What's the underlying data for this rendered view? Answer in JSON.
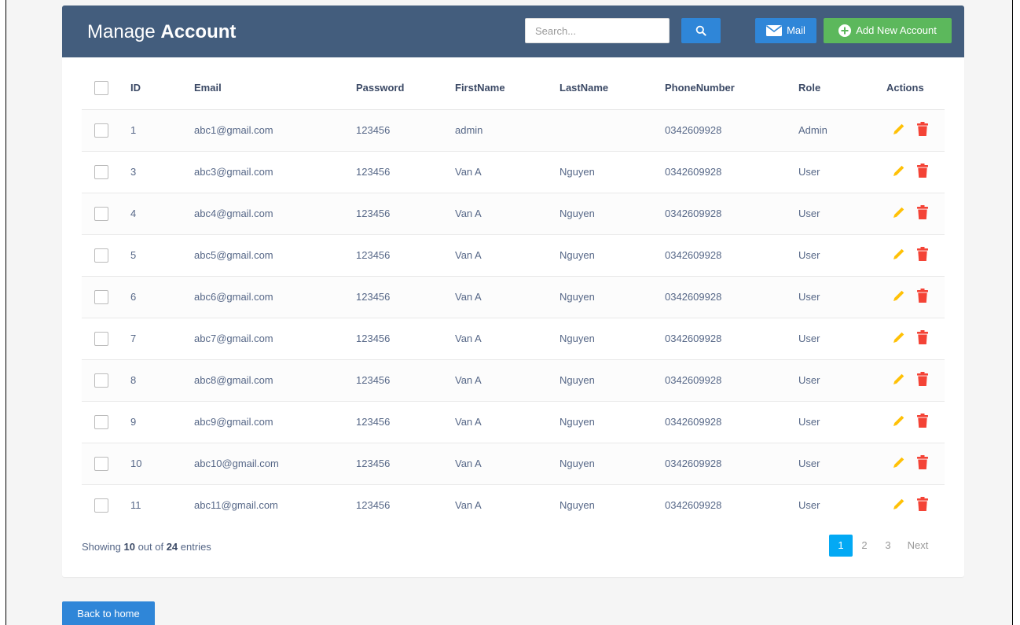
{
  "header": {
    "title_light": "Manage ",
    "title_bold": "Account",
    "search_placeholder": "Search...",
    "mail_label": "Mail",
    "add_label": "Add New Account"
  },
  "colors": {
    "header_bg": "#435d7d",
    "primary": "#2f86d8",
    "success": "#5cb85c",
    "edit_icon": "#ffc107",
    "delete_icon": "#f44336",
    "active_page": "#03a9f4"
  },
  "icons": {
    "search": "search-icon",
    "mail": "envelope-icon",
    "add": "plus-circle-icon",
    "edit": "pencil-icon",
    "delete": "trash-icon"
  },
  "table": {
    "columns": [
      "ID",
      "Email",
      "Password",
      "FirstName",
      "LastName",
      "PhoneNumber",
      "Role",
      "Actions"
    ],
    "rows": [
      {
        "id": "1",
        "email": "abc1@gmail.com",
        "password": "123456",
        "first": "admin",
        "last": "",
        "phone": "0342609928",
        "role": "Admin"
      },
      {
        "id": "3",
        "email": "abc3@gmail.com",
        "password": "123456",
        "first": "Van A",
        "last": "Nguyen",
        "phone": "0342609928",
        "role": "User"
      },
      {
        "id": "4",
        "email": "abc4@gmail.com",
        "password": "123456",
        "first": "Van A",
        "last": "Nguyen",
        "phone": "0342609928",
        "role": "User"
      },
      {
        "id": "5",
        "email": "abc5@gmail.com",
        "password": "123456",
        "first": "Van A",
        "last": "Nguyen",
        "phone": "0342609928",
        "role": "User"
      },
      {
        "id": "6",
        "email": "abc6@gmail.com",
        "password": "123456",
        "first": "Van A",
        "last": "Nguyen",
        "phone": "0342609928",
        "role": "User"
      },
      {
        "id": "7",
        "email": "abc7@gmail.com",
        "password": "123456",
        "first": "Van A",
        "last": "Nguyen",
        "phone": "0342609928",
        "role": "User"
      },
      {
        "id": "8",
        "email": "abc8@gmail.com",
        "password": "123456",
        "first": "Van A",
        "last": "Nguyen",
        "phone": "0342609928",
        "role": "User"
      },
      {
        "id": "9",
        "email": "abc9@gmail.com",
        "password": "123456",
        "first": "Van A",
        "last": "Nguyen",
        "phone": "0342609928",
        "role": "User"
      },
      {
        "id": "10",
        "email": "abc10@gmail.com",
        "password": "123456",
        "first": "Van A",
        "last": "Nguyen",
        "phone": "0342609928",
        "role": "User"
      },
      {
        "id": "11",
        "email": "abc11@gmail.com",
        "password": "123456",
        "first": "Van A",
        "last": "Nguyen",
        "phone": "0342609928",
        "role": "User"
      }
    ]
  },
  "footer": {
    "showing_prefix": "Showing ",
    "showing_count": "10",
    "showing_mid": " out of ",
    "showing_total": "24",
    "showing_suffix": " entries",
    "pages": [
      "1",
      "2",
      "3"
    ],
    "next_label": "Next"
  },
  "back_label": "Back to home"
}
